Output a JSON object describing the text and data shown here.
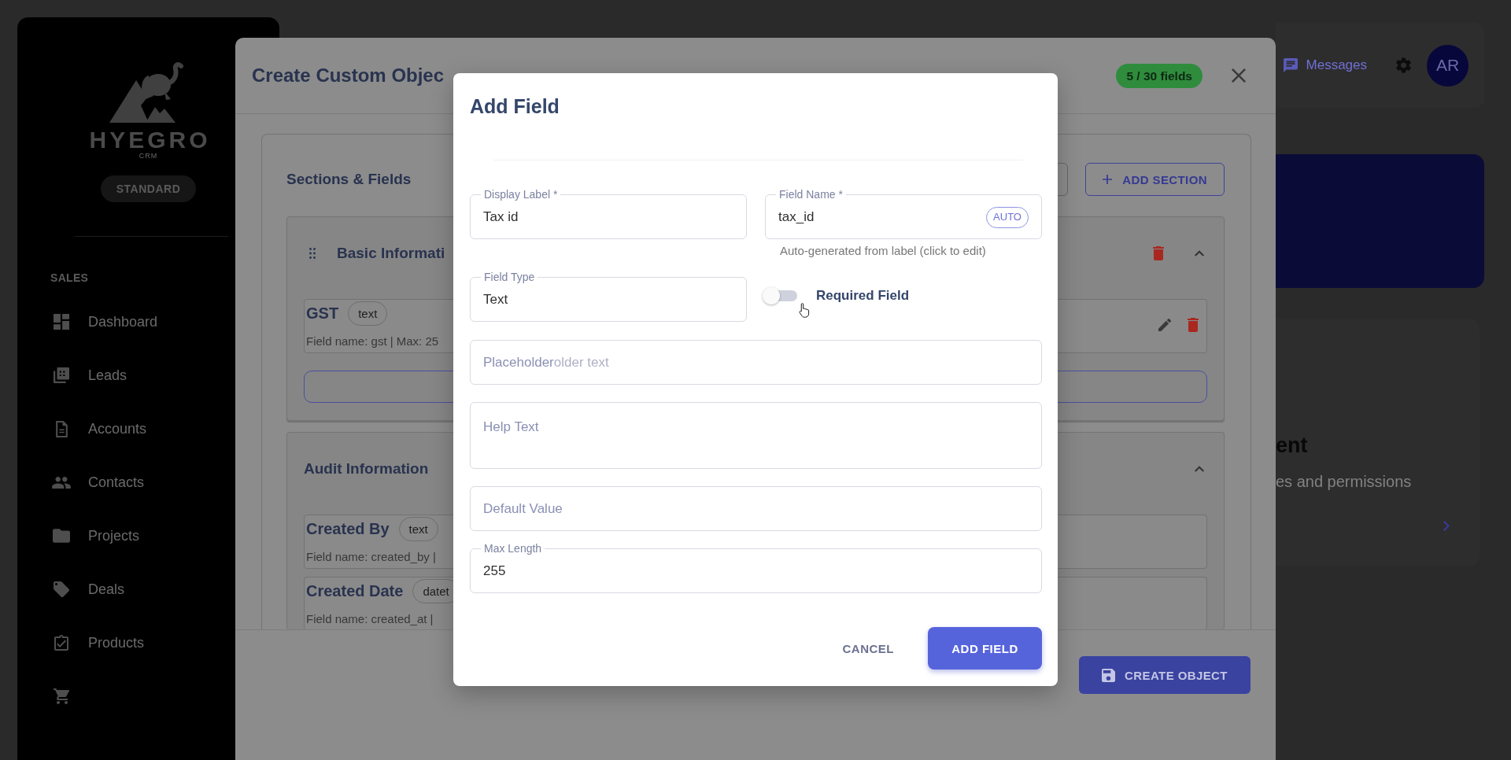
{
  "sidebar": {
    "brand": "HYEGRO",
    "brand_subtitle": "CRM",
    "plan": "STANDARD",
    "section_heading": "SALES",
    "items": [
      {
        "label": "Dashboard"
      },
      {
        "label": "Leads"
      },
      {
        "label": "Accounts"
      },
      {
        "label": "Contacts"
      },
      {
        "label": "Projects"
      },
      {
        "label": "Deals"
      },
      {
        "label": "Products"
      }
    ]
  },
  "topbar": {
    "messages": "Messages",
    "avatar_initials": "AR"
  },
  "custom_object_modal": {
    "title": "Create Custom Objec",
    "field_count": "5 / 30 fields",
    "sections_heading": "Sections & Fields",
    "add_section_button": "ADD SECTION",
    "sections": [
      {
        "title": "Basic Informati",
        "draggable": true,
        "deletable": true,
        "expanded": true,
        "has_add_button": true,
        "fields": [
          {
            "name": "GST",
            "type": "text",
            "meta": "Field name: gst | Max: 25",
            "editable": true
          }
        ]
      },
      {
        "title": "Audit Information",
        "draggable": false,
        "deletable": false,
        "expanded": true,
        "has_add_button": false,
        "fields": [
          {
            "name": "Created By",
            "type": "text",
            "meta": "Field name: created_by |",
            "editable": false
          },
          {
            "name": "Created Date",
            "type": "datet",
            "meta": "Field name: created_at |",
            "editable": false
          }
        ]
      }
    ],
    "create_button": "CREATE OBJECT"
  },
  "permissions_card": {
    "title": "ent",
    "description": "es and permissions"
  },
  "add_field_dialog": {
    "title": "Add Field",
    "grid_fields": [
      {
        "kind": "text",
        "label": "Display Label *",
        "value": "Tax id"
      },
      {
        "kind": "text",
        "label": "Field Name *",
        "value": "tax_id",
        "badge": "AUTO",
        "helper": "Auto-generated from label (click to edit)"
      },
      {
        "kind": "select",
        "label": "Field Type",
        "value": "Text"
      },
      {
        "kind": "switch",
        "label": "Required Field",
        "on": false
      }
    ],
    "fields": [
      {
        "kind": "text",
        "placeholder": "Placeholder",
        "faded_text": "older text"
      },
      {
        "kind": "textarea",
        "placeholder": "Help Text"
      },
      {
        "kind": "text",
        "placeholder": "Default Value"
      },
      {
        "kind": "text",
        "label": "Max Length",
        "value": "255"
      }
    ],
    "buttons": [
      {
        "kind": "text",
        "label": "CANCEL"
      },
      {
        "kind": "primary",
        "label": "ADD FIELD"
      }
    ]
  }
}
